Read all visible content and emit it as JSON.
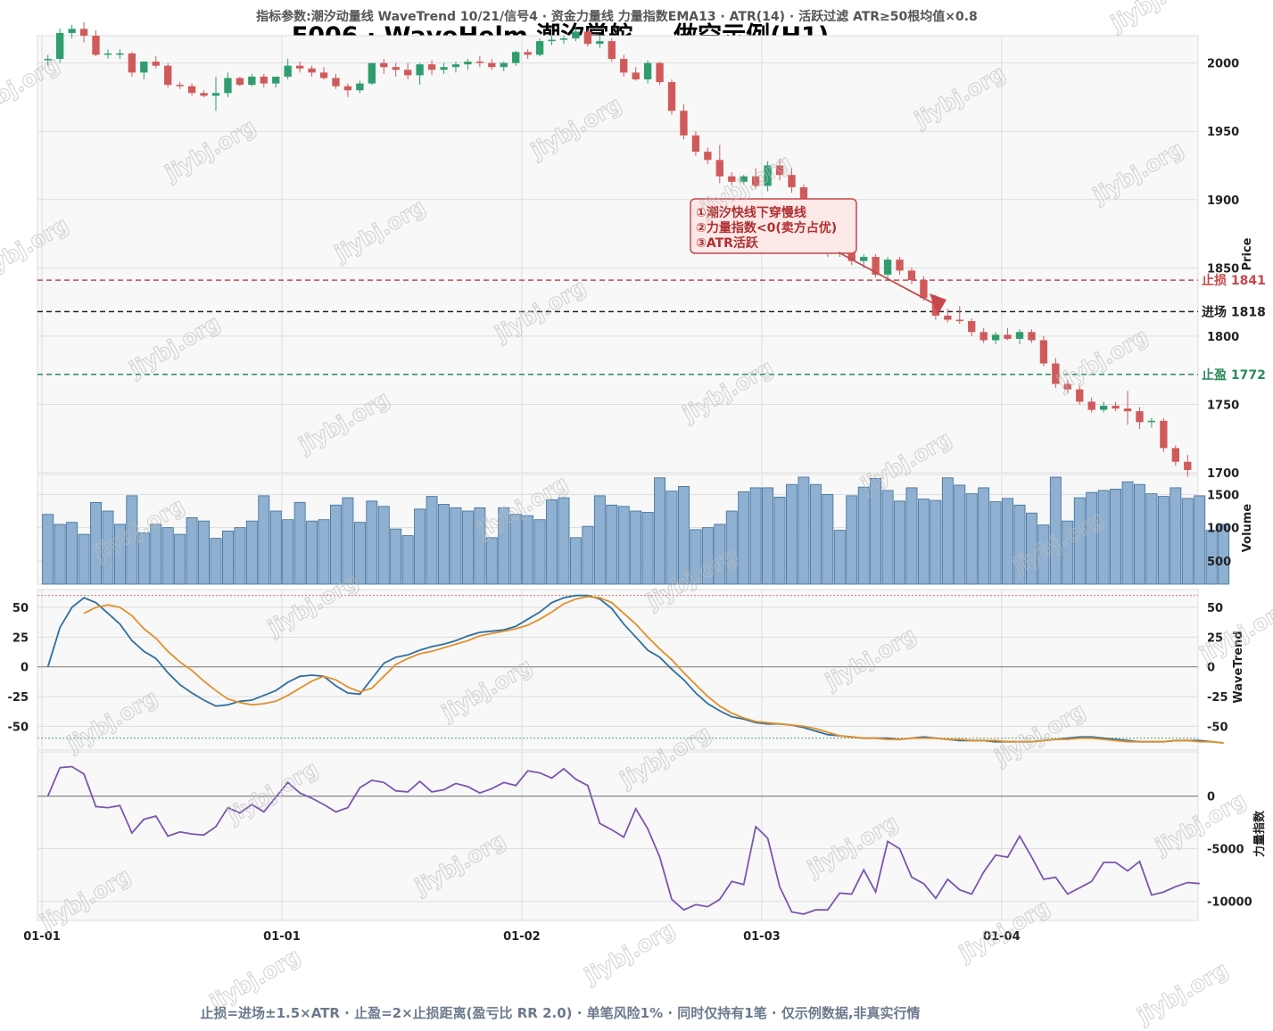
{
  "header": {
    "params": "指标参数:潮汐动量线 WaveTrend 10/21/信号4 · 资金力量线 力量指数EMA13 · ATR(14) · 活跃过滤 ATR≥50根均值×0.8",
    "title": "E006 · WaveHelm 潮汐掌舵 — 做空示例(H1)"
  },
  "footer": {
    "text": "止损=进场±1.5×ATR · 止盈=2×止损距离(盈亏比 RR 2.0) · 单笔风险1% · 同时仅持有1笔 · 仅示例数据,非真实行情"
  },
  "watermark": "jiybj.org",
  "colors": {
    "up": "#2e9e6e",
    "down": "#d05a5a",
    "volume": "#8fb0d0",
    "volume_edge": "#3b6e9c",
    "wt_fast": "#2f6f9f",
    "wt_slow": "#e0902a",
    "force": "#7b55b0",
    "stop": "#c8474a",
    "entry": "#222222",
    "target": "#2a8a5a"
  },
  "annotation": {
    "lines": [
      "①潮汐快线下穿慢线",
      "②力量指数<0(卖方占优)",
      "③ATR活跃"
    ]
  },
  "chart_data": {
    "type": "candlestick",
    "x_ticks": [
      "01-01",
      "01-01",
      "01-02",
      "01-03",
      "01-04"
    ],
    "x_tick_index": [
      0,
      20,
      40,
      60,
      80
    ],
    "price": {
      "ylabel": "Price",
      "ylim": [
        1700,
        2020
      ],
      "yticks": [
        1700,
        1750,
        1800,
        1850,
        1900,
        1950,
        2000
      ],
      "levels": [
        {
          "label": "止损 1841",
          "value": 1841,
          "style": "stop"
        },
        {
          "label": "进场 1818",
          "value": 1818,
          "style": "entry"
        },
        {
          "label": "止盈 1772",
          "value": 1772,
          "style": "target"
        }
      ],
      "ohlc": [
        [
          2002,
          2006,
          1998,
          2003
        ],
        [
          2003,
          2025,
          2000,
          2022
        ],
        [
          2022,
          2028,
          2018,
          2025
        ],
        [
          2025,
          2030,
          2015,
          2020
        ],
        [
          2020,
          2024,
          2005,
          2006
        ],
        [
          2006,
          2010,
          2003,
          2007
        ],
        [
          2007,
          2010,
          2003,
          2007
        ],
        [
          2007,
          2008,
          1990,
          1993
        ],
        [
          1993,
          2001,
          1988,
          2001
        ],
        [
          2001,
          2005,
          1996,
          1998
        ],
        [
          1998,
          2000,
          1982,
          1984
        ],
        [
          1984,
          1986,
          1981,
          1983
        ],
        [
          1983,
          1985,
          1976,
          1978
        ],
        [
          1978,
          1980,
          1975,
          1976
        ],
        [
          1976,
          1990,
          1965,
          1978
        ],
        [
          1978,
          1993,
          1975,
          1989
        ],
        [
          1989,
          1990,
          1983,
          1984
        ],
        [
          1984,
          1992,
          1983,
          1990
        ],
        [
          1990,
          1992,
          1982,
          1985
        ],
        [
          1985,
          1990,
          1982,
          1990
        ],
        [
          1990,
          2003,
          1988,
          1998
        ],
        [
          1998,
          2001,
          1993,
          1996
        ],
        [
          1996,
          1998,
          1990,
          1993
        ],
        [
          1993,
          1997,
          1988,
          1989
        ],
        [
          1989,
          1992,
          1981,
          1983
        ],
        [
          1983,
          1985,
          1975,
          1980
        ],
        [
          1980,
          1987,
          1978,
          1985
        ],
        [
          1985,
          2000,
          1984,
          2000
        ],
        [
          2000,
          2003,
          1992,
          1997
        ],
        [
          1997,
          2000,
          1990,
          1995
        ],
        [
          1995,
          2000,
          1988,
          1991
        ],
        [
          1991,
          2000,
          1984,
          1999
        ],
        [
          1999,
          2002,
          1991,
          1995
        ],
        [
          1995,
          2000,
          1992,
          1997
        ],
        [
          1997,
          2001,
          1993,
          1999
        ],
        [
          1999,
          2003,
          1995,
          2001
        ],
        [
          2001,
          2005,
          1997,
          2000
        ],
        [
          2000,
          2003,
          1995,
          1997
        ],
        [
          1997,
          2001,
          1994,
          2000
        ],
        [
          2000,
          2009,
          1998,
          2008
        ],
        [
          2008,
          2010,
          2003,
          2006
        ],
        [
          2006,
          2018,
          2005,
          2016
        ],
        [
          2016,
          2020,
          2013,
          2017
        ],
        [
          2017,
          2020,
          2014,
          2018
        ],
        [
          2018,
          2026,
          2016,
          2023
        ],
        [
          2023,
          2024,
          2012,
          2014
        ],
        [
          2014,
          2020,
          2011,
          2016
        ],
        [
          2016,
          2018,
          2001,
          2003
        ],
        [
          2003,
          2006,
          1990,
          1993
        ],
        [
          1993,
          1997,
          1987,
          1988
        ],
        [
          1988,
          2002,
          1985,
          2000
        ],
        [
          2000,
          2001,
          1984,
          1986
        ],
        [
          1986,
          1988,
          1962,
          1965
        ],
        [
          1965,
          1970,
          1944,
          1947
        ],
        [
          1947,
          1950,
          1932,
          1935
        ],
        [
          1935,
          1938,
          1926,
          1929
        ],
        [
          1929,
          1940,
          1912,
          1917
        ],
        [
          1917,
          1920,
          1910,
          1913
        ],
        [
          1913,
          1918,
          1911,
          1917
        ],
        [
          1917,
          1923,
          1908,
          1910
        ],
        [
          1910,
          1928,
          1906,
          1925
        ],
        [
          1925,
          1930,
          1914,
          1918
        ],
        [
          1918,
          1923,
          1905,
          1909
        ],
        [
          1909,
          1911,
          1880,
          1885
        ],
        [
          1885,
          1888,
          1866,
          1870
        ],
        [
          1870,
          1873,
          1858,
          1861
        ],
        [
          1861,
          1866,
          1858,
          1864
        ],
        [
          1864,
          1866,
          1852,
          1855
        ],
        [
          1855,
          1860,
          1850,
          1858
        ],
        [
          1858,
          1860,
          1843,
          1845
        ],
        [
          1845,
          1858,
          1842,
          1856
        ],
        [
          1856,
          1858,
          1845,
          1848
        ],
        [
          1848,
          1850,
          1838,
          1841
        ],
        [
          1841,
          1844,
          1826,
          1828
        ],
        [
          1828,
          1830,
          1812,
          1815
        ],
        [
          1815,
          1820,
          1810,
          1812
        ],
        [
          1812,
          1822,
          1809,
          1811
        ],
        [
          1811,
          1813,
          1800,
          1803
        ],
        [
          1803,
          1806,
          1795,
          1797
        ],
        [
          1797,
          1803,
          1794,
          1801
        ],
        [
          1801,
          1806,
          1797,
          1798
        ],
        [
          1798,
          1805,
          1794,
          1803
        ],
        [
          1803,
          1805,
          1795,
          1797
        ],
        [
          1797,
          1800,
          1778,
          1780
        ],
        [
          1780,
          1784,
          1762,
          1765
        ],
        [
          1765,
          1768,
          1758,
          1761
        ],
        [
          1761,
          1764,
          1750,
          1752
        ],
        [
          1752,
          1755,
          1744,
          1746
        ],
        [
          1746,
          1752,
          1744,
          1749
        ],
        [
          1749,
          1752,
          1745,
          1747
        ],
        [
          1747,
          1760,
          1735,
          1745
        ],
        [
          1745,
          1748,
          1732,
          1737
        ],
        [
          1737,
          1740,
          1733,
          1738
        ],
        [
          1738,
          1740,
          1715,
          1718
        ],
        [
          1718,
          1720,
          1705,
          1708
        ],
        [
          1708,
          1713,
          1697,
          1702
        ]
      ]
    },
    "volume": {
      "ylabel": "Volume",
      "ylim": [
        150,
        1800
      ],
      "yticks": [
        500,
        1000,
        1500
      ],
      "values": [
        1200,
        1050,
        1080,
        900,
        1380,
        1250,
        1050,
        1480,
        920,
        1050,
        1000,
        900,
        1150,
        1100,
        840,
        950,
        1000,
        1100,
        1480,
        1250,
        1120,
        1380,
        1100,
        1120,
        1340,
        1450,
        1080,
        1400,
        1320,
        980,
        880,
        1280,
        1470,
        1350,
        1300,
        1250,
        1300,
        850,
        1300,
        1200,
        1180,
        1120,
        1420,
        1450,
        850,
        1020,
        1480,
        1340,
        1320,
        1250,
        1230,
        1750,
        1550,
        1620,
        970,
        1000,
        1050,
        1250,
        1540,
        1600,
        1600,
        1460,
        1650,
        1760,
        1650,
        1500,
        960,
        1480,
        1610,
        1740,
        1560,
        1400,
        1600,
        1430,
        1410,
        1750,
        1640,
        1510,
        1600,
        1390,
        1440,
        1340,
        1220,
        1040,
        1760,
        1100,
        1450,
        1530,
        1560,
        1580,
        1690,
        1650,
        1510,
        1470,
        1600,
        1440,
        1480,
        960,
        1050
      ]
    },
    "wavetrend": {
      "ylabel": "WaveTrend",
      "ylim": [
        -70,
        65
      ],
      "yticks": [
        -50,
        -25,
        0,
        25,
        50
      ],
      "overbought": 60,
      "oversold": -60,
      "series": [
        {
          "role": "fast",
          "values": [
            0,
            33,
            50,
            58,
            54,
            45,
            36,
            22,
            13,
            7,
            -5,
            -15,
            -22,
            -28,
            -33,
            -32,
            -29,
            -28,
            -24,
            -20,
            -13,
            -8,
            -7,
            -8,
            -16,
            -22,
            -23,
            -10,
            3,
            8,
            10,
            14,
            17,
            19,
            22,
            26,
            29,
            30,
            31,
            34,
            40,
            46,
            54,
            58,
            60,
            60,
            57,
            49,
            36,
            25,
            14,
            8,
            -2,
            -11,
            -22,
            -31,
            -37,
            -42,
            -44,
            -47,
            -48,
            -48,
            -49,
            -51,
            -54,
            -57,
            -58,
            -59,
            -60,
            -60,
            -60,
            -61,
            -60,
            -59,
            -60,
            -61,
            -62,
            -62,
            -62,
            -63,
            -63,
            -63,
            -63,
            -62,
            -61,
            -60,
            -59,
            -59,
            -60,
            -61,
            -62,
            -63,
            -63,
            -63,
            -62,
            -62,
            -62,
            -63,
            -64
          ]
        },
        {
          "role": "slow",
          "values": [
            null,
            null,
            null,
            45,
            50,
            52,
            50,
            43,
            32,
            24,
            13,
            4,
            -3,
            -12,
            -20,
            -27,
            -30,
            -32,
            -31,
            -29,
            -24,
            -18,
            -12,
            -8,
            -11,
            -17,
            -21,
            -18,
            -8,
            2,
            7,
            11,
            13,
            16,
            19,
            22,
            26,
            28,
            30,
            32,
            35,
            40,
            46,
            53,
            57,
            59,
            58,
            54,
            45,
            36,
            25,
            15,
            6,
            -5,
            -15,
            -25,
            -33,
            -39,
            -43,
            -46,
            -47,
            -48,
            -49,
            -50,
            -52,
            -55,
            -58,
            -59,
            -60,
            -60,
            -61,
            -61,
            -60,
            -60,
            -60,
            -61,
            -61,
            -62,
            -62,
            -62,
            -63,
            -63,
            -63,
            -62,
            -61,
            -61,
            -60,
            -60,
            -61,
            -62,
            -63,
            -63,
            -63,
            -63,
            -62,
            -62,
            -63,
            -63,
            -64
          ]
        }
      ]
    },
    "force_index": {
      "ylabel": "力量指数",
      "ylim": [
        -11800,
        4200
      ],
      "yticks": [
        -10000,
        -5000,
        0
      ],
      "values": [
        0,
        2700,
        2800,
        2100,
        -1000,
        -1100,
        -900,
        -3500,
        -2200,
        -1900,
        -3800,
        -3400,
        -3600,
        -3700,
        -2900,
        -1100,
        -1600,
        -800,
        -1500,
        -100,
        1300,
        300,
        -200,
        -800,
        -1500,
        -1100,
        800,
        1500,
        1300,
        500,
        400,
        1400,
        400,
        600,
        1200,
        900,
        300,
        700,
        1300,
        1000,
        2400,
        2200,
        1700,
        2600,
        1600,
        1000,
        -2600,
        -3200,
        -3900,
        -1200,
        -3100,
        -5800,
        -9800,
        -10800,
        -10300,
        -10500,
        -9800,
        -8100,
        -8400,
        -2900,
        -4000,
        -8600,
        -11000,
        -11200,
        -10800,
        -10800,
        -9200,
        -9300,
        -7000,
        -9100,
        -4300,
        -5000,
        -7700,
        -8300,
        -9700,
        -7900,
        -8900,
        -9300,
        -7200,
        -5600,
        -5800,
        -3800,
        -5800,
        -7900,
        -7700,
        -9300,
        -8700,
        -8100,
        -6300,
        -6300,
        -7100,
        -6200,
        -9400,
        -9100,
        -8600,
        -8200,
        -8300
      ]
    }
  }
}
